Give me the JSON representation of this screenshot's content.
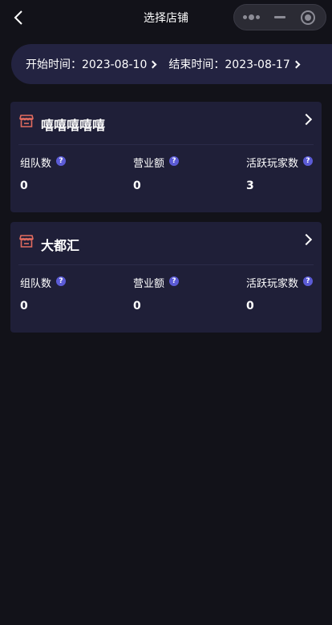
{
  "nav": {
    "title": "选择店铺"
  },
  "filter": {
    "start_label": "开始时间：2023-08-10",
    "end_label": "结束时间：2023-08-17"
  },
  "stores": [
    {
      "name": "嘻嘻嘻嘻嘻",
      "stats": [
        {
          "label": "组队数",
          "value": "0"
        },
        {
          "label": "营业额",
          "value": "0"
        },
        {
          "label": "活跃玩家数",
          "value": "3"
        }
      ]
    },
    {
      "name": "大都汇",
      "stats": [
        {
          "label": "组队数",
          "value": "0"
        },
        {
          "label": "营业额",
          "value": "0"
        },
        {
          "label": "活跃玩家数",
          "value": "0"
        }
      ]
    }
  ],
  "icons": {
    "back": "chevron-left-icon",
    "more": "more-dots-icon",
    "minimize": "minimize-icon",
    "close": "target-close-icon",
    "store": "store-icon",
    "help": "question-icon",
    "arrow": "chevron-right-icon"
  },
  "colors": {
    "background": "#121219",
    "card": "#1f1f38",
    "date_bar": "#232341",
    "store_icon": "#e26b5f",
    "help_badge": "#5b5bd6"
  }
}
